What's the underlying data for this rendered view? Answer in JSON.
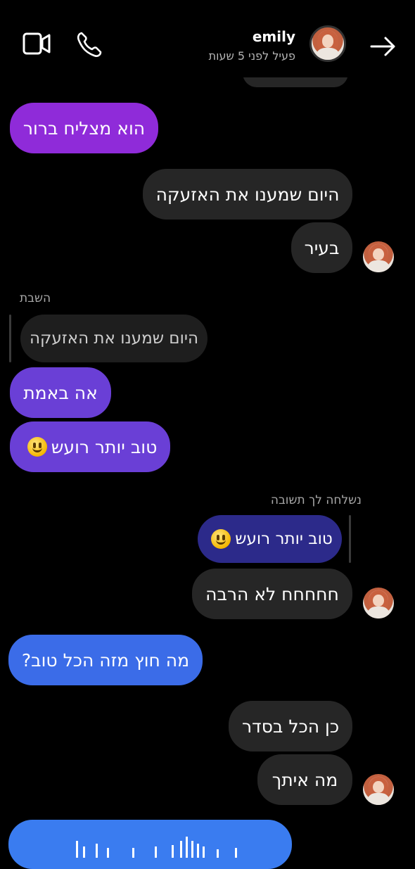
{
  "header": {
    "contact_name": "emily",
    "status": "פעיל לפני 5 שעות"
  },
  "icons": {
    "back": "arrow-right-icon",
    "call": "phone-icon",
    "video": "video-camera-icon"
  },
  "messages": [
    {
      "side": "left",
      "color": "purple",
      "text": "הוא מצליח ברור"
    },
    {
      "side": "right",
      "text": "היום שמענו את האזעקה"
    },
    {
      "side": "right",
      "text": "בעיר"
    },
    {
      "reply_label": "השבת",
      "quoted": "היום שמענו את האזעקה"
    },
    {
      "side": "left",
      "color": "violet",
      "text": "אה באמת"
    },
    {
      "side": "left",
      "color": "violet",
      "text": "טוב יותר רועש",
      "emoji": "grinning-face"
    },
    {
      "reply_label": "נשלחה לך תשובה",
      "quoted": "טוב יותר רועש",
      "emoji": "grinning-face"
    },
    {
      "side": "right",
      "text": "חחחחח לא הרבה"
    },
    {
      "side": "left",
      "color": "blue",
      "text": "מה חוץ מזה הכל טוב?"
    },
    {
      "side": "right",
      "text": "כן הכל בסדר"
    },
    {
      "side": "right",
      "text": "מה איתך"
    }
  ],
  "colors": {
    "background": "#000000",
    "incoming_gray": "#262626",
    "purple": "#8f2bd9",
    "violet": "#6a3fd6",
    "blue": "#3b6ce8",
    "reply_quote": "#2c2a8a",
    "voice_note": "#3a7cf0"
  }
}
